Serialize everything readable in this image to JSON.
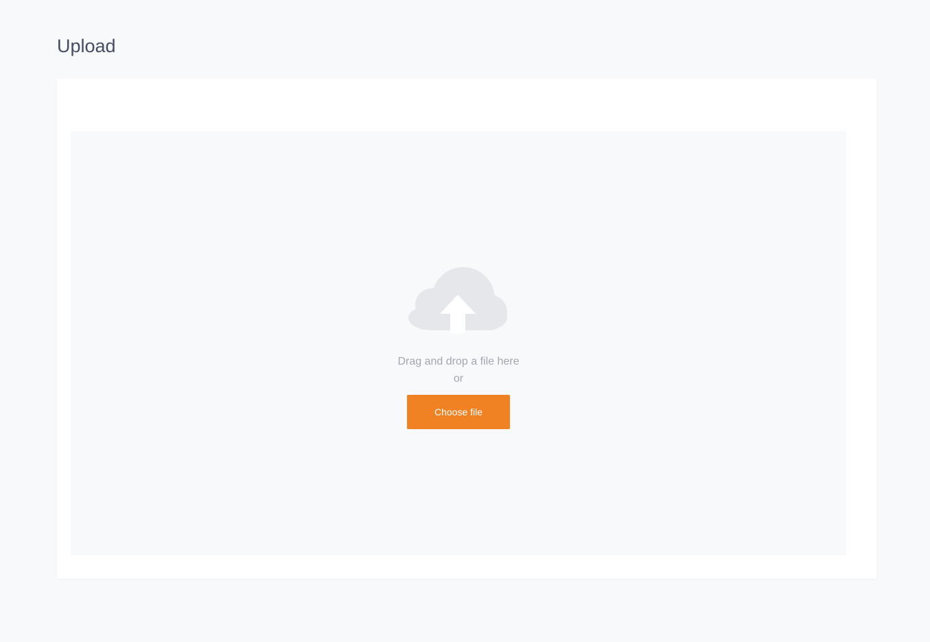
{
  "page": {
    "title": "Upload"
  },
  "dropzone": {
    "icon": "cloud-upload-icon",
    "drag_text": "Drag and drop a file here",
    "or_text": "or",
    "choose_button_label": "Choose file"
  },
  "colors": {
    "accent": "#f08223",
    "background": "#f8f9fb",
    "card": "#ffffff",
    "icon": "#e6e7ea",
    "muted_text": "#a3a6ae"
  }
}
